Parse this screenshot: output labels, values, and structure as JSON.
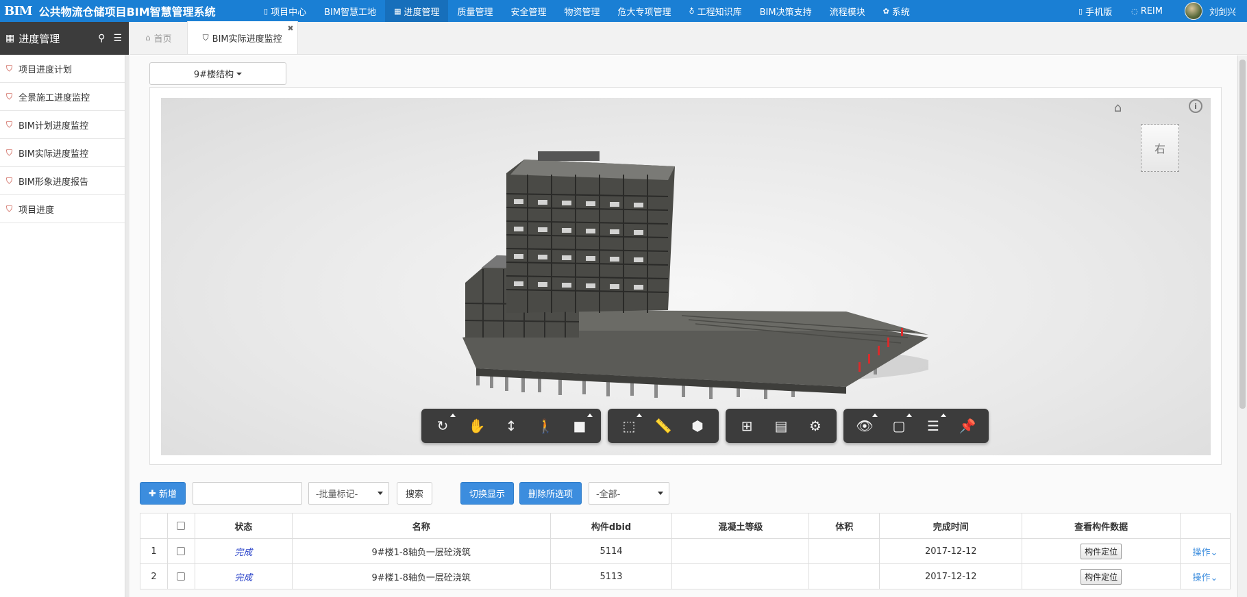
{
  "app": {
    "logo": "BIM",
    "title": "公共物流仓储项目BIM智慧管理系统"
  },
  "nav": {
    "items": [
      {
        "label": "项目中心",
        "icon": "document-icon",
        "glyph": "▯"
      },
      {
        "label": "BIM智慧工地",
        "icon": "",
        "glyph": ""
      },
      {
        "label": "进度管理",
        "icon": "bar-chart-icon",
        "glyph": "▦"
      },
      {
        "label": "质量管理",
        "icon": "",
        "glyph": ""
      },
      {
        "label": "安全管理",
        "icon": "",
        "glyph": ""
      },
      {
        "label": "物资管理",
        "icon": "",
        "glyph": ""
      },
      {
        "label": "危大专项管理",
        "icon": "",
        "glyph": ""
      },
      {
        "label": "工程知识库",
        "icon": "lightbulb-icon",
        "glyph": "♁"
      },
      {
        "label": "BIM决策支持",
        "icon": "",
        "glyph": ""
      },
      {
        "label": "流程模块",
        "icon": "",
        "glyph": ""
      },
      {
        "label": "系统",
        "icon": "gear-icon",
        "glyph": "✿"
      }
    ],
    "active_index": 2,
    "mobile": "手机版",
    "reim": "REIM",
    "user": "刘剑兴"
  },
  "sidebar": {
    "title": "进度管理",
    "items": [
      {
        "label": "项目进度计划"
      },
      {
        "label": "全景施工进度监控"
      },
      {
        "label": "BIM计划进度监控"
      },
      {
        "label": "BIM实际进度监控"
      },
      {
        "label": "BIM形象进度报告"
      },
      {
        "label": "项目进度"
      }
    ]
  },
  "tabs": {
    "home": "首页",
    "current": "BIM实际进度监控"
  },
  "viewer": {
    "model_select": "9#楼结构",
    "viewcube_face": "右",
    "info_label": "i"
  },
  "actions": {
    "add": "新增",
    "batch_placeholder": "-批量标记-",
    "search": "搜索",
    "toggle_display": "切换显示",
    "delete_selected": "删除所选项",
    "filter_all": "-全部-"
  },
  "table": {
    "headers": [
      "状态",
      "名称",
      "构件dbid",
      "混凝土等级",
      "体积",
      "完成时间",
      "查看构件数据"
    ],
    "rows": [
      {
        "index": "1",
        "status": "完成",
        "name": "9#楼1-8轴负一层砼浇筑",
        "dbid": "5114",
        "grade": "",
        "volume": "",
        "date": "2017-12-12",
        "locate": "构件定位",
        "op": "操作"
      },
      {
        "index": "2",
        "status": "完成",
        "name": "9#楼1-8轴负一层砼浇筑",
        "dbid": "5113",
        "grade": "",
        "volume": "",
        "date": "2017-12-12",
        "locate": "构件定位",
        "op": "操作"
      }
    ]
  },
  "colors": {
    "topbar": "#1a7fd4",
    "primary_button": "#3c8dde",
    "sidebar_header": "#3c3c3c",
    "status_text": "#2a43c9"
  }
}
